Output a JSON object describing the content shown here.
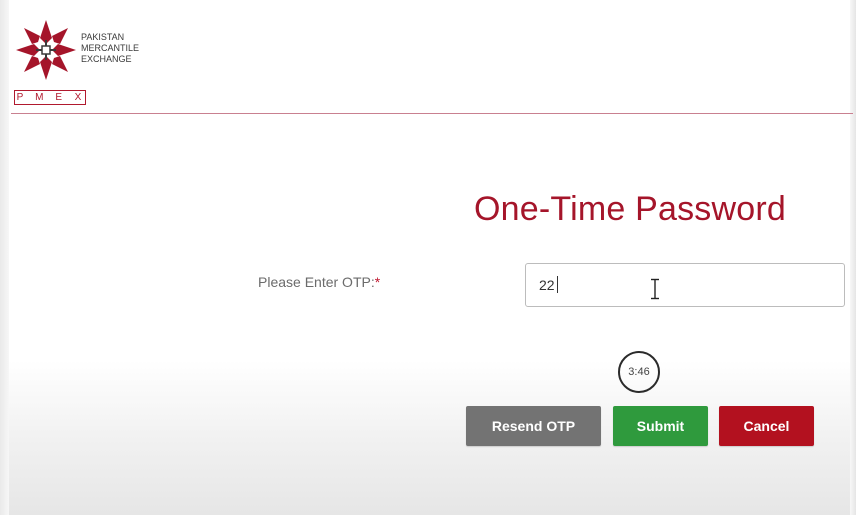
{
  "brand": {
    "name_lines": [
      "Pakistan",
      "Mercantile",
      "Exchange"
    ],
    "acronym_letters": [
      "P",
      "M",
      "E",
      "X"
    ],
    "accent_color": "#a5152a"
  },
  "page": {
    "title": "One-Time Password"
  },
  "form": {
    "otp_label": "Please Enter OTP:",
    "required_marker": "*",
    "otp_value": "22"
  },
  "timer": {
    "remaining": "3:46"
  },
  "buttons": {
    "resend_label": "Resend OTP",
    "submit_label": "Submit",
    "cancel_label": "Cancel",
    "resend_color": "#737373",
    "submit_color": "#2f9a3d",
    "cancel_color": "#b3111f"
  }
}
